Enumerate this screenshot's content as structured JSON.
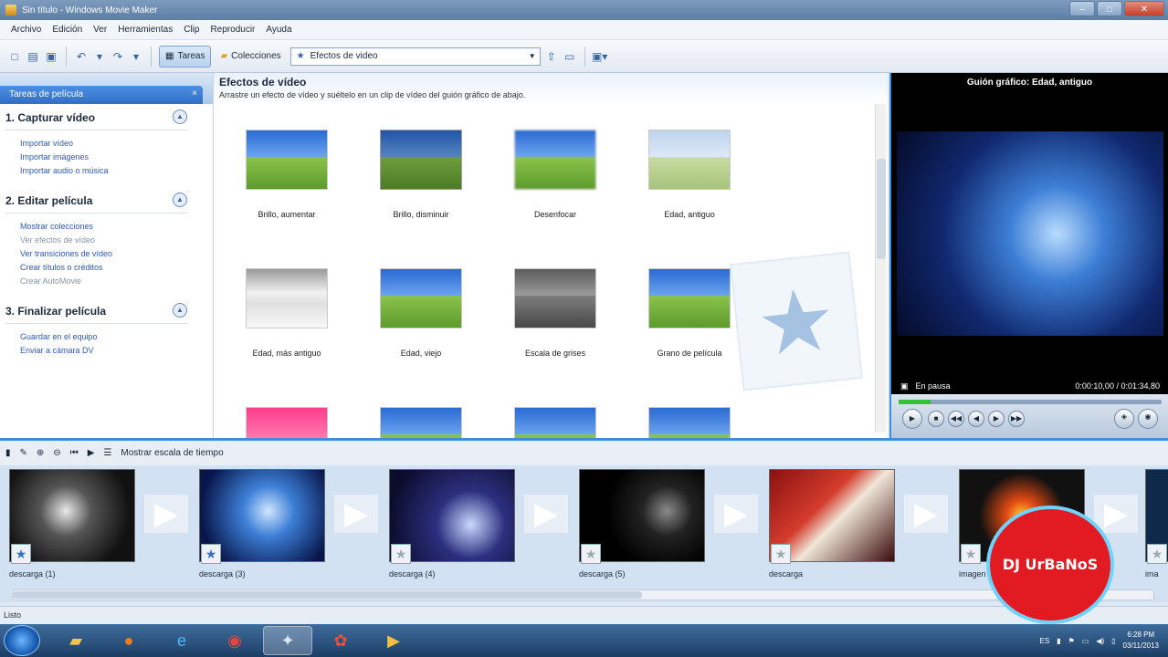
{
  "window": {
    "title": "Sin título - Windows Movie Maker",
    "minimize": "–",
    "maximize": "□",
    "close": "✕"
  },
  "menu": [
    "Archivo",
    "Edición",
    "Ver",
    "Herramientas",
    "Clip",
    "Reproducir",
    "Ayuda"
  ],
  "toolbar": {
    "tasks_label": "Tareas",
    "collections_label": "Colecciones",
    "collection_select": "Efectos de video"
  },
  "task_pane": {
    "tab_label": "Tareas de película",
    "tab_close": "×",
    "sections": [
      {
        "title": "1. Capturar vídeo",
        "links": [
          "Importar vídeo",
          "Importar imágenes",
          "Importar audio o música"
        ],
        "disabled": [
          false,
          false,
          false
        ]
      },
      {
        "title": "2. Editar película",
        "links": [
          "Mostrar colecciones",
          "Ver efectos de vídeo",
          "Ver transiciones de vídeo",
          "Crear títulos o créditos",
          "Crear AutoMovie"
        ],
        "disabled": [
          false,
          true,
          false,
          false,
          true
        ]
      },
      {
        "title": "3. Finalizar película",
        "links": [
          "Guardar en el equipo",
          "Enviar a cámara DV"
        ],
        "disabled": [
          false,
          false
        ]
      }
    ]
  },
  "effects": {
    "title": "Efectos de vídeo",
    "subtitle": "Arrastre un efecto de vídeo y suéltelo en un clip de vídeo del guión gráfico de abajo.",
    "items": [
      "Brillo, aumentar",
      "Brillo, disminuir",
      "Desenfocar",
      "Edad, antiguo",
      "Edad, más antiguo",
      "Edad, viejo",
      "Escala de grises",
      "Grano de película"
    ]
  },
  "preview": {
    "title": "Guión gráfico: Edad, antiguo",
    "status": "En pausa",
    "time": "0:00:10,00 / 0:01:34,80",
    "progress": 0.12
  },
  "storyboard": {
    "show_timeline": "Mostrar escala de tiempo",
    "clips": [
      {
        "name": "descarga (1)",
        "effect": true
      },
      {
        "name": "descarga (3)",
        "effect": true
      },
      {
        "name": "descarga (4)",
        "effect": false
      },
      {
        "name": "descarga (5)",
        "effect": false
      },
      {
        "name": "descarga",
        "effect": false
      },
      {
        "name": "imagen",
        "effect": false
      },
      {
        "name": "ima",
        "effect": false
      }
    ]
  },
  "statusbar": {
    "text": "Listo"
  },
  "taskbar": {
    "lang": "ES",
    "time": "6:28 PM",
    "date": "03/11/2013"
  },
  "watermark": {
    "text": "DJ UrBaNoS"
  }
}
